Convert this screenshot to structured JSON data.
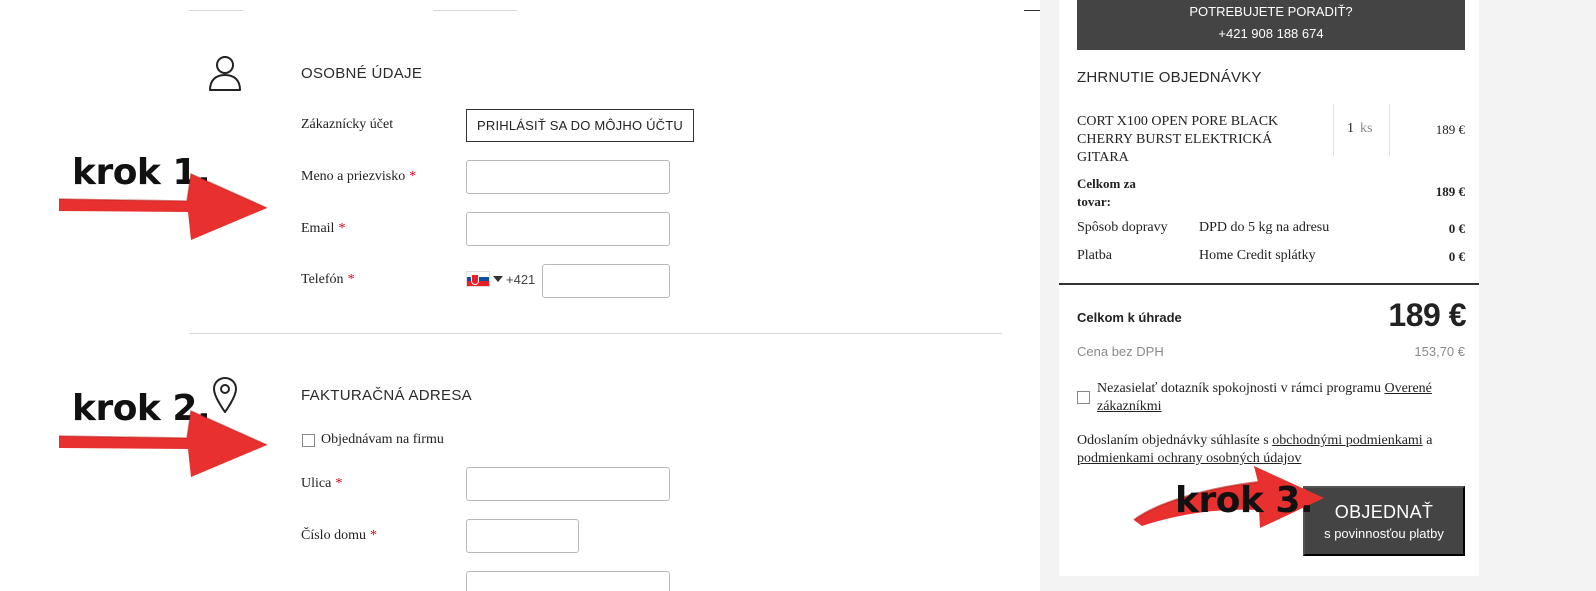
{
  "personal": {
    "title": "OSOBNÉ ÚDAJE",
    "account_label": "Zákaznícky účet",
    "login_button": "PRIHLÁSIŤ SA DO MÔJHO ÚČTU",
    "name_label": "Meno a priezvisko",
    "email_label": "Email",
    "phone_label": "Telefón",
    "phone_prefix": "+421",
    "required_mark": "*"
  },
  "billing": {
    "title": "FAKTURAČNÁ ADRESA",
    "company_checkbox_label": "Objednávam na firmu",
    "street_label": "Ulica",
    "house_number_label": "Číslo domu"
  },
  "annotations": {
    "step1": "krok 1.",
    "step2": "krok 2.",
    "step3": "krok 3."
  },
  "sidebar": {
    "help_line1": "POTREBUJETE PORADIŤ?",
    "help_line2": "+421 908 188 674",
    "summary_title": "ZHRNUTIE OBJEDNÁVKY",
    "item": {
      "name": "CORT X100 OPEN PORE BLACK CHERRY BURST ELEKTRICKÁ GITARA",
      "qty": "1",
      "unit": "ks",
      "price": "189 €"
    },
    "goods_total_label": "Celkom za tovar:",
    "goods_total_value": "189 €",
    "shipping_label": "Spôsob dopravy",
    "shipping_method": "DPD do 5 kg na adresu",
    "shipping_value": "0 €",
    "payment_label": "Platba",
    "payment_method": "Home Credit splátky",
    "payment_value": "0 €",
    "total_label": "Celkom k úhrade",
    "total_value": "189 €",
    "no_vat_label": "Cena bez DPH",
    "no_vat_value": "153,70 €",
    "survey_text": "Nezasielať dotazník spokojnosti v rámci programu",
    "survey_link": "Overené zákazníkmi",
    "terms_prefix": "Odoslaním objednávky súhlasíte s",
    "terms_link1": "obchodnými podmienkami",
    "terms_and": "a",
    "terms_link2": "podmienkami ochrany osobných údajov",
    "order_button_main": "OBJEDNAŤ",
    "order_button_sub": "s povinnosťou platby"
  },
  "colors": {
    "arrow": "#e8302f",
    "dark_button": "#444444",
    "required": "#d0021b"
  }
}
